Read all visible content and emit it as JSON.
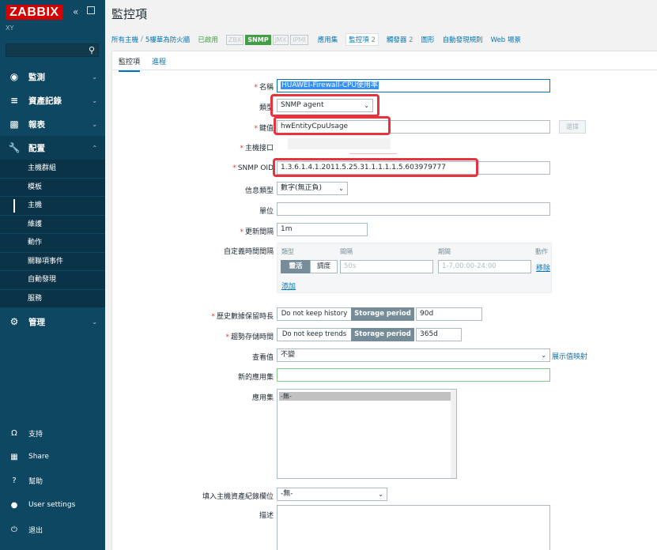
{
  "sidebar": {
    "logo": "ZABBIX",
    "collapse_icon": "«",
    "server_name": "XY",
    "search_icon": "🔍",
    "menus": [
      {
        "label": "監測",
        "icon": "eye-icon"
      },
      {
        "label": "資產記錄",
        "icon": "list-icon"
      },
      {
        "label": "報表",
        "icon": "chart-icon"
      },
      {
        "label": "配置",
        "icon": "wrench-icon"
      },
      {
        "label": "管理",
        "icon": "gear-icon"
      }
    ],
    "submenu": [
      "主機群組",
      "模板",
      "主機",
      "維護",
      "動作",
      "關聯項事件",
      "自動發現",
      "服務"
    ],
    "bottom": [
      "支持",
      "Share",
      "幫助",
      "User settings",
      "退出"
    ]
  },
  "page_title": "監控項",
  "breadcrumbs": {
    "all_hosts": "所有主機",
    "separator": "/",
    "host": "5樓華為防火牆",
    "status": "已啟用",
    "tags": [
      "ZBX",
      "SNMP",
      "JMX",
      "IPMI"
    ],
    "applications": "應用集",
    "items": "監控項",
    "items_count": "2",
    "triggers": "觸發器",
    "triggers_count": "2",
    "graphs": "圖形",
    "discovery": "自動發現規則",
    "web": "Web 場景"
  },
  "tabs": [
    "監控項",
    "進程"
  ],
  "form": {
    "name_label": "名稱",
    "name_value": "HUAWEI-Firewall-CPU使用率",
    "type_label": "類型",
    "type_value": "SNMP agent",
    "key_label": "鍵值",
    "key_value": "hwEntityCpuUsage",
    "select_button": "選擇",
    "interface_label": "主機接口",
    "oid_label": "SNMP OID",
    "oid_value": "1.3.6.1.4.1.2011.5.25.31.1.1.1.1.5.603979777",
    "info_type_label": "信息類型",
    "info_type_value": "數字(無正負)",
    "units_label": "單位",
    "interval_label": "更新間隔",
    "interval_value": "1m",
    "custom_intervals_label": "自定義時間間隔",
    "ci_headers": [
      "類型",
      "間隔",
      "期間",
      "動作"
    ],
    "ci_types": [
      "靈活",
      "調度"
    ],
    "ci_interval_placeholder": "50s",
    "ci_period_placeholder": "1-7,00:00-24:00",
    "ci_remove": "移除",
    "ci_add": "添加",
    "history_label": "歷史數據保留時長",
    "history_options": [
      "Do not keep history",
      "Storage period"
    ],
    "history_value": "90d",
    "trends_label": "趨勢存儲時間",
    "trends_options": [
      "Do not keep trends",
      "Storage period"
    ],
    "trends_value": "365d",
    "show_value_label": "查看值",
    "show_value_value": "不變",
    "show_value_link": "展示值映射",
    "new_app_label": "新的應用集",
    "apps_label": "應用集",
    "apps_option": "-無-",
    "inventory_label": "填入主機資產紀錄欄位",
    "inventory_value": "-無-",
    "description_label": "描述"
  },
  "colors": {
    "sidebar": "#0e4762",
    "logo": "#d40000",
    "link": "#0275b8",
    "highlight": "#e8333e",
    "enabled": "#429e47"
  }
}
